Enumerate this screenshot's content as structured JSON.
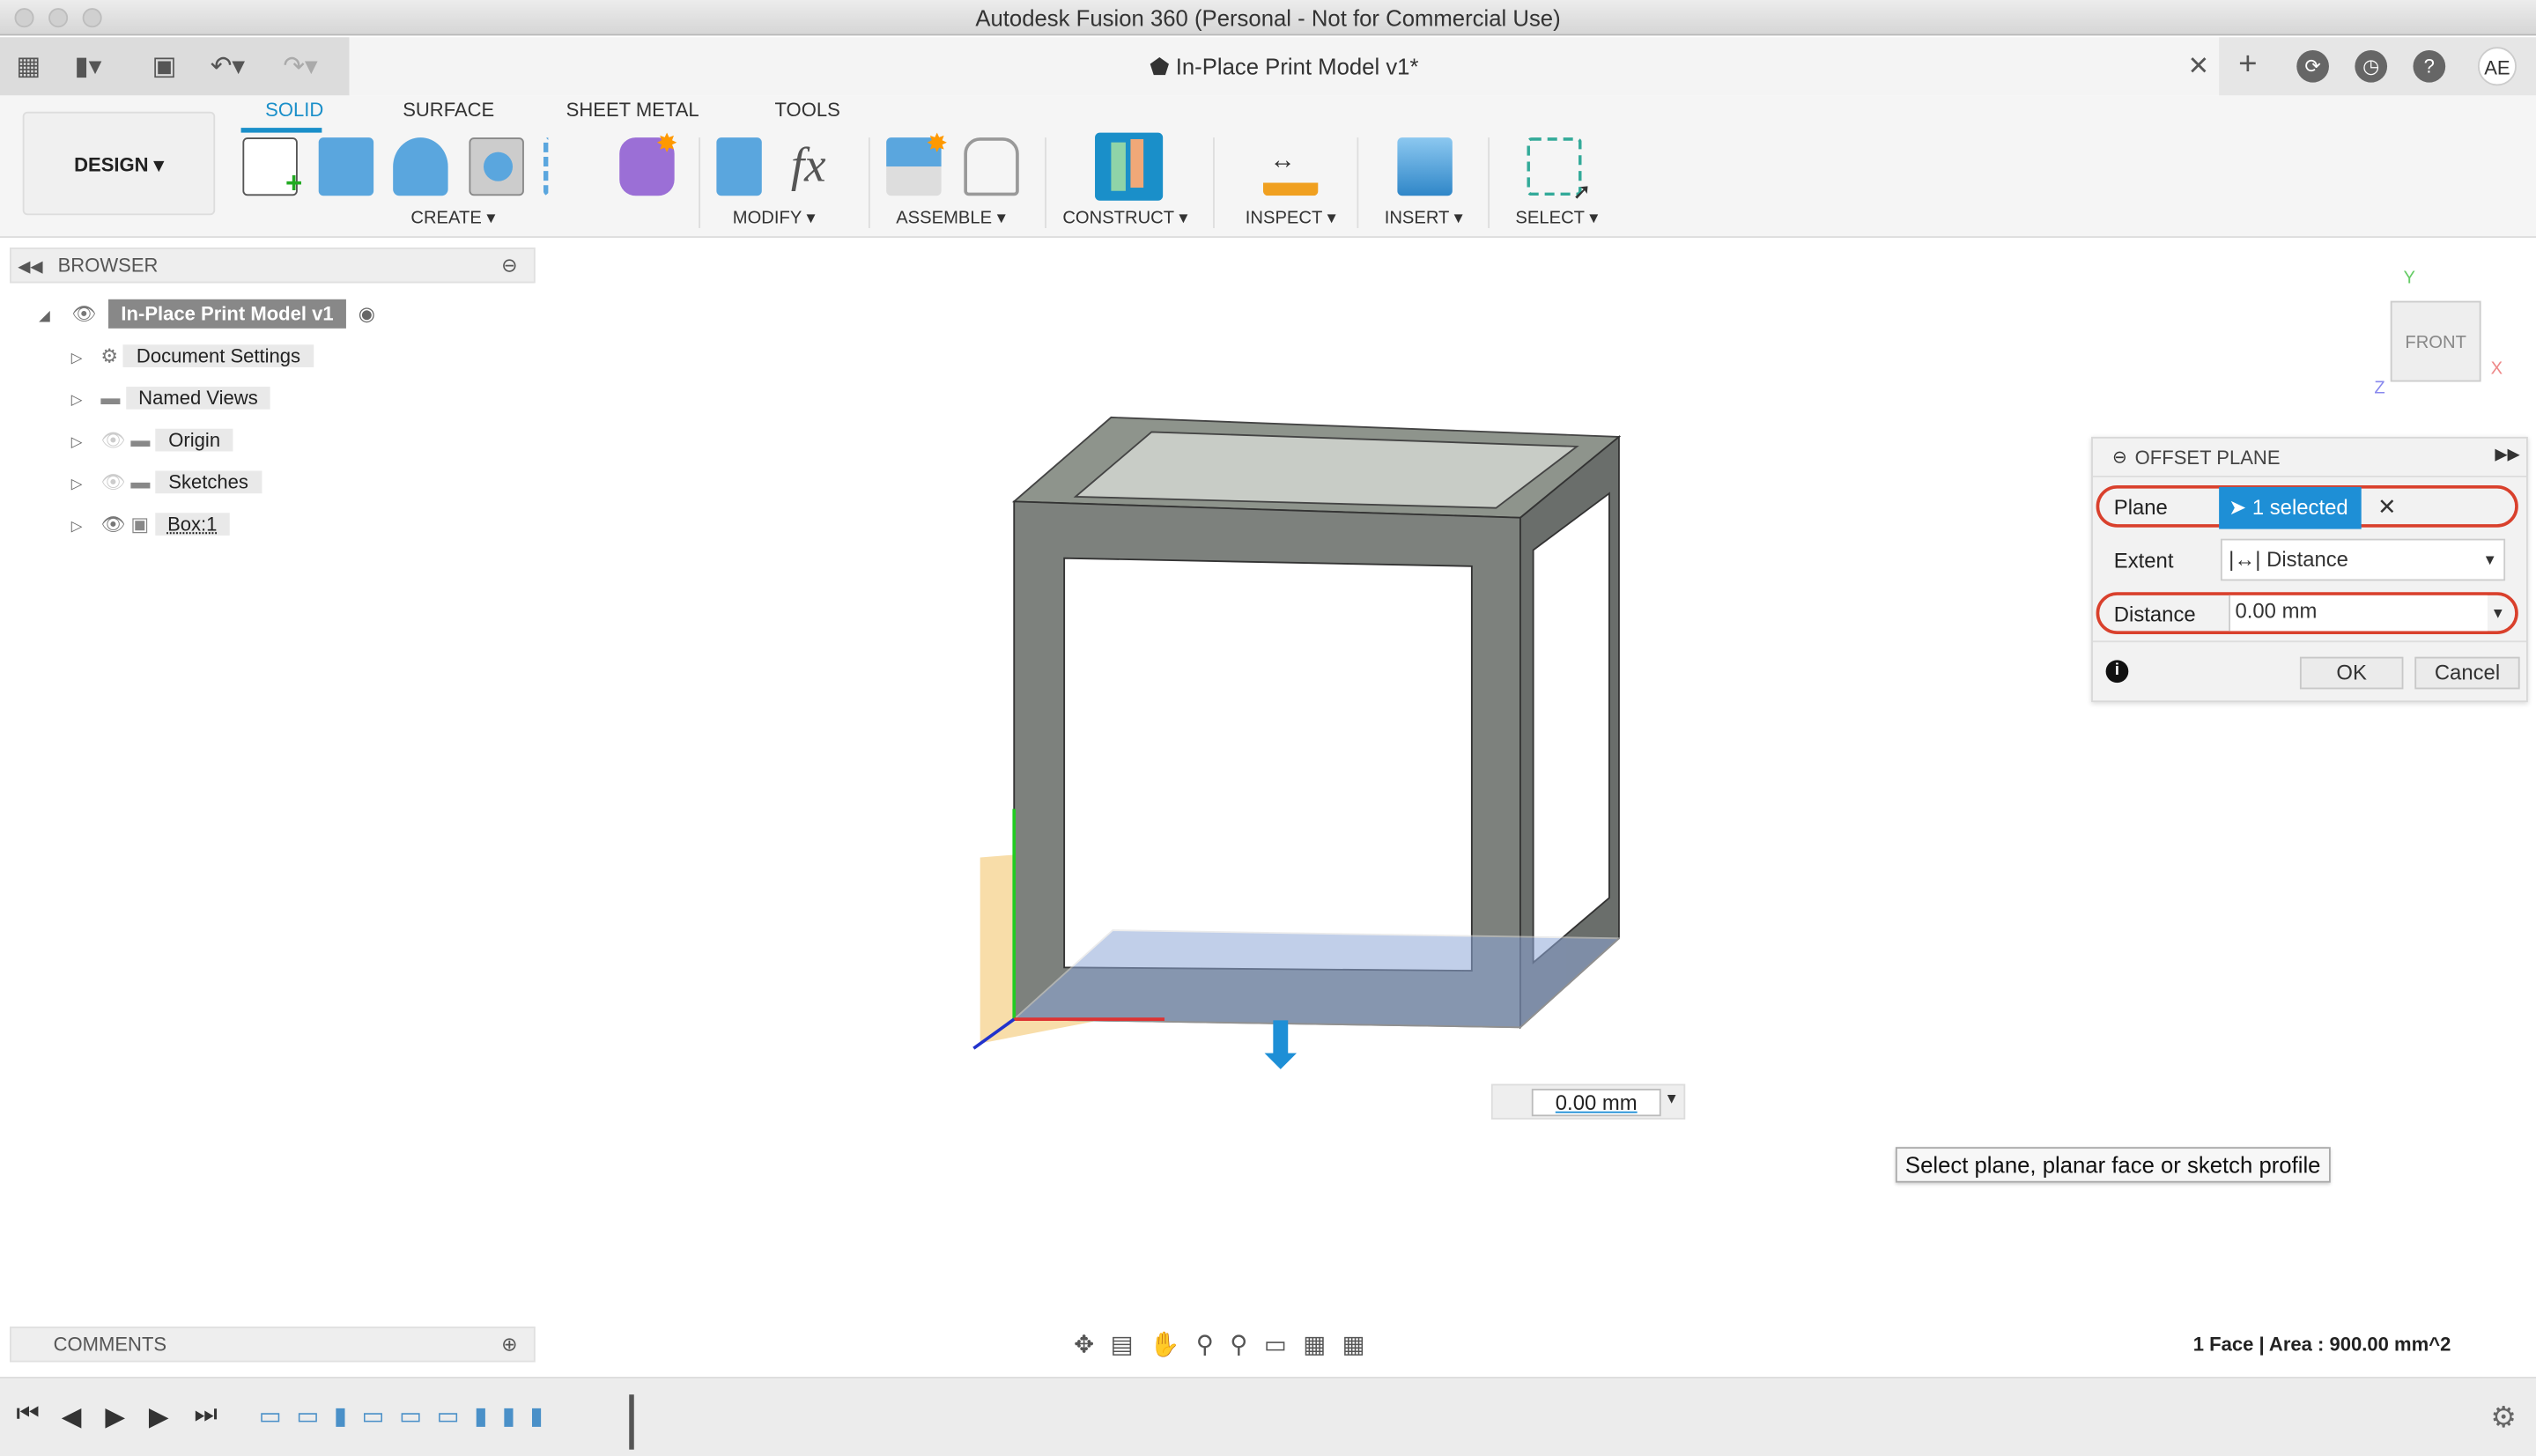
{
  "window": {
    "title": "Autodesk Fusion 360 (Personal - Not for Commercial Use)"
  },
  "document": {
    "tab_title": "In-Place Print Model v1*",
    "user_initials": "AE"
  },
  "ribbon": {
    "workspace": "DESIGN ▾",
    "tabs": [
      "SOLID",
      "SURFACE",
      "SHEET METAL",
      "TOOLS"
    ],
    "active_tab": "SOLID",
    "groups": [
      "CREATE ▾",
      "MODIFY ▾",
      "ASSEMBLE ▾",
      "CONSTRUCT ▾",
      "INSPECT ▾",
      "INSERT ▾",
      "SELECT ▾"
    ]
  },
  "browser": {
    "title": "BROWSER",
    "root": "In-Place Print Model v1",
    "items": [
      "Document Settings",
      "Named Views",
      "Origin",
      "Sketches",
      "Box:1"
    ]
  },
  "comments": {
    "title": "COMMENTS"
  },
  "dialog": {
    "title": "OFFSET PLANE",
    "plane_label": "Plane",
    "plane_value": "1 selected",
    "extent_label": "Extent",
    "extent_value": "Distance",
    "distance_label": "Distance",
    "distance_value": "0.00 mm",
    "ok": "OK",
    "cancel": "Cancel"
  },
  "viewport": {
    "distance_input": "0.00 mm",
    "tooltip": "Select plane, planar face or sketch profile",
    "viewcube_face": "FRONT",
    "status": "1 Face | Area : 900.00 mm^2"
  },
  "colors": {
    "accent": "#1a8fc9",
    "highlight": "#d9402c",
    "selection": "#1e8fd6"
  }
}
